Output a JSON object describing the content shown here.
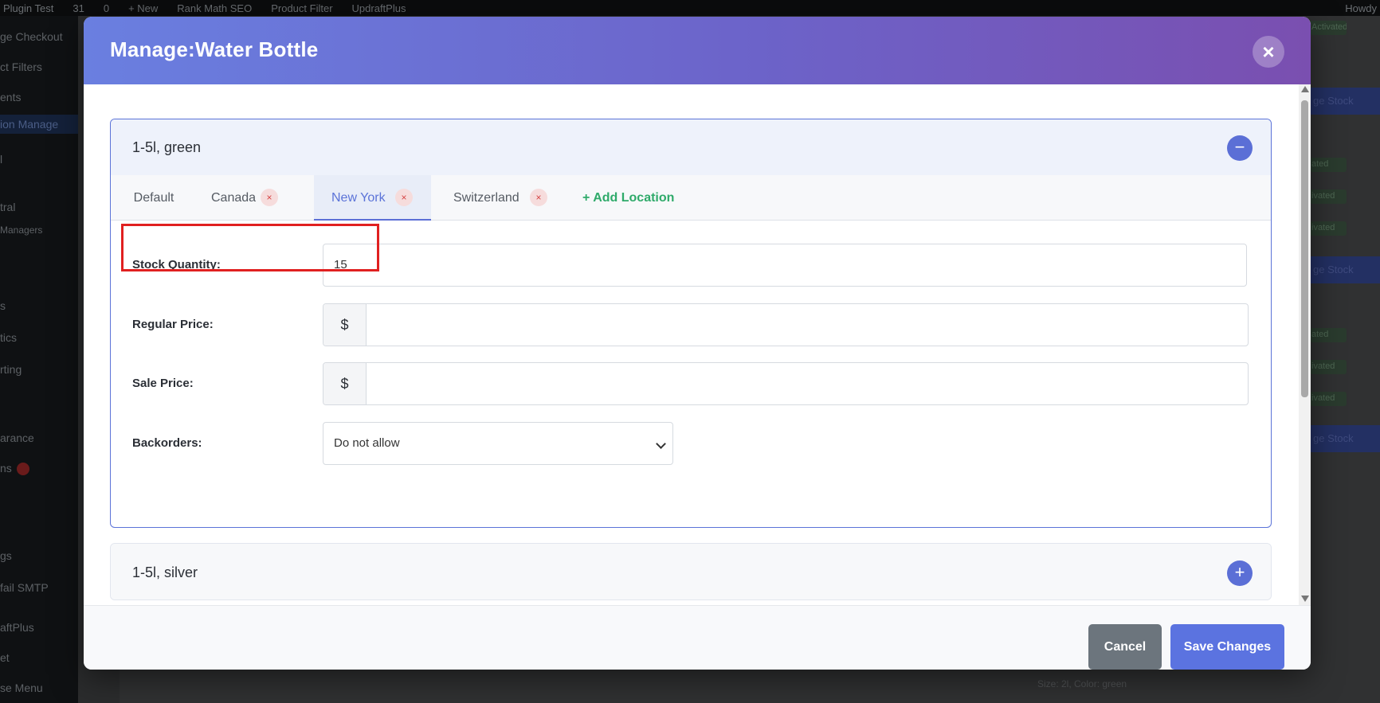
{
  "background": {
    "topbar_items": [
      "Plugin Test",
      "31",
      "0",
      "+ New",
      "Rank Math SEO",
      "Product Filter",
      "UpdraftPlus",
      "Howdy"
    ],
    "sidebar_items": [
      "ge Checkout",
      "ct Filters",
      "ents",
      "ion Manage",
      "l",
      "tral",
      "Managers",
      "s",
      "tics",
      "rting",
      "arance",
      "ns",
      "gs",
      "fail SMTP",
      "aftPlus",
      "et",
      "se Menu"
    ],
    "right_buttons": [
      "ge Stock",
      "ge Stock",
      "ge Stock"
    ],
    "right_pills": [
      "Activated",
      "ated",
      "ivated",
      "ivated",
      "ated",
      "ivated",
      "ivated"
    ],
    "bottom_text": "Size: 2l, Color: green"
  },
  "modal": {
    "title": "Manage:Water Bottle",
    "close_label": "×"
  },
  "variations": [
    {
      "title": "1-5l, green",
      "toggle": "−",
      "expanded": true,
      "tabs": [
        {
          "label": "Default",
          "removable": false
        },
        {
          "label": "Canada",
          "removable": true
        },
        {
          "label": "New York",
          "removable": true,
          "active": true
        },
        {
          "label": "Switzerland",
          "removable": true
        }
      ],
      "tab_remove_label": "×",
      "add_location_label": "+ Add Location",
      "fields": {
        "stock_label": "Stock Quantity:",
        "stock_value": "15",
        "regular_price_label": "Regular Price:",
        "regular_price_value": "",
        "sale_price_label": "Sale Price:",
        "sale_price_value": "",
        "currency_symbol": "$",
        "backorders_label": "Backorders:",
        "backorders_value": "Do not allow"
      }
    },
    {
      "title": "1-5l, silver",
      "toggle": "+",
      "expanded": false
    }
  ],
  "footer": {
    "cancel_label": "Cancel",
    "save_label": "Save Changes"
  },
  "colors": {
    "accent": "#5b73e0",
    "add_location": "#2faa6a",
    "remove": "#d64545",
    "highlight": "#e02020"
  }
}
